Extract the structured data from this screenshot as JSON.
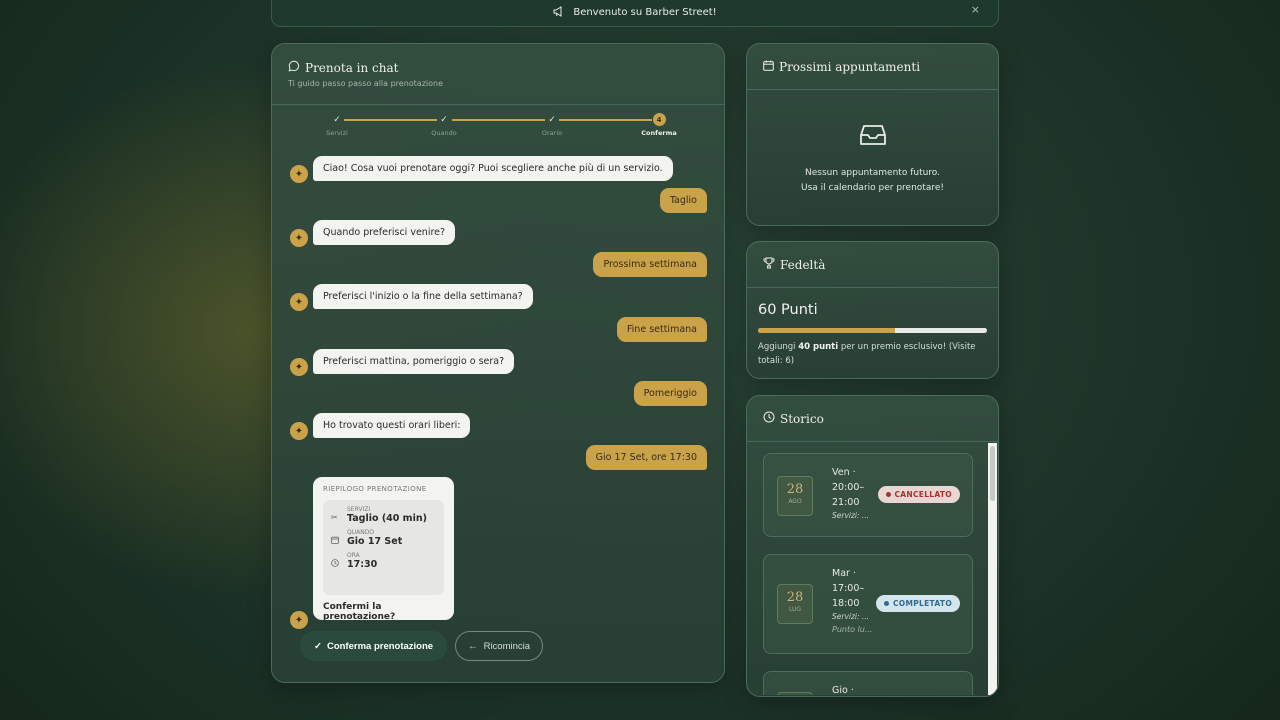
{
  "banner": {
    "icon": "megaphone-icon",
    "text": "Benvenuto su Barber Street!",
    "close": "×"
  },
  "chat": {
    "title": "Prenota in chat",
    "subtitle": "Ti guido passo passo alla prenotazione",
    "steps": [
      {
        "label": "Servizi",
        "state": "done",
        "marker": "✓"
      },
      {
        "label": "Quando",
        "state": "done",
        "marker": "✓"
      },
      {
        "label": "Orario",
        "state": "done",
        "marker": "✓"
      },
      {
        "label": "Conferma",
        "state": "active",
        "marker": "4"
      }
    ],
    "messages": [
      {
        "from": "bot",
        "text": "Ciao! Cosa vuoi prenotare oggi? Puoi scegliere anche più di un servizio."
      },
      {
        "from": "user",
        "text": "Taglio"
      },
      {
        "from": "bot",
        "text": "Quando preferisci venire?"
      },
      {
        "from": "user",
        "text": "Prossima settimana"
      },
      {
        "from": "bot",
        "text": "Preferisci l'inizio o la fine della settimana?"
      },
      {
        "from": "user",
        "text": "Fine settimana"
      },
      {
        "from": "bot",
        "text": "Preferisci mattina, pomeriggio o sera?"
      },
      {
        "from": "user",
        "text": "Pomeriggio"
      },
      {
        "from": "bot",
        "text": "Ho trovato questi orari liberi:"
      },
      {
        "from": "user",
        "text": "Gio 17 Set, ore 17:30"
      }
    ],
    "summary": {
      "heading": "RIEPILOGO PRENOTAZIONE",
      "services_label": "SERVIZI",
      "services_value": "Taglio (40 min)",
      "when_label": "QUANDO",
      "when_value": "Gio 17 Set",
      "time_label": "ORA",
      "time_value": "17:30",
      "question": "Confermi la prenotazione?"
    },
    "confirm_label": "Conferma prenotazione",
    "restart_label": "Ricomincia"
  },
  "appointments": {
    "title": "Prossimi appuntamenti",
    "empty_line1": "Nessun appuntamento futuro.",
    "empty_line2": "Usa il calendario per prenotare!"
  },
  "loyalty": {
    "title": "Fedeltà",
    "points": "60 Punti",
    "progress": 0.6,
    "text_before": "Aggiungi ",
    "text_bold": "40 punti",
    "text_after": " per un premio esclusivo! (Visite totali: 6)"
  },
  "history": {
    "title": "Storico",
    "items": [
      {
        "day": "28",
        "month": "AGO",
        "weekday": "Ven ·",
        "start": "20:00–",
        "end": "21:00",
        "services": "Servizi: ...",
        "status": "CANCELLATO",
        "status_type": "cancel"
      },
      {
        "day": "28",
        "month": "LUG",
        "weekday": "Mar ·",
        "start": "17:00–",
        "end": "18:00",
        "services": "Servizi: ...",
        "points": "Punto lu...",
        "status": "COMPLETATO",
        "status_type": "done"
      },
      {
        "weekday": "Gio ·"
      }
    ]
  },
  "colors": {
    "accent": "#c9a24a",
    "panel": "#2f4d3e",
    "bubble": "#f3f3f0"
  }
}
